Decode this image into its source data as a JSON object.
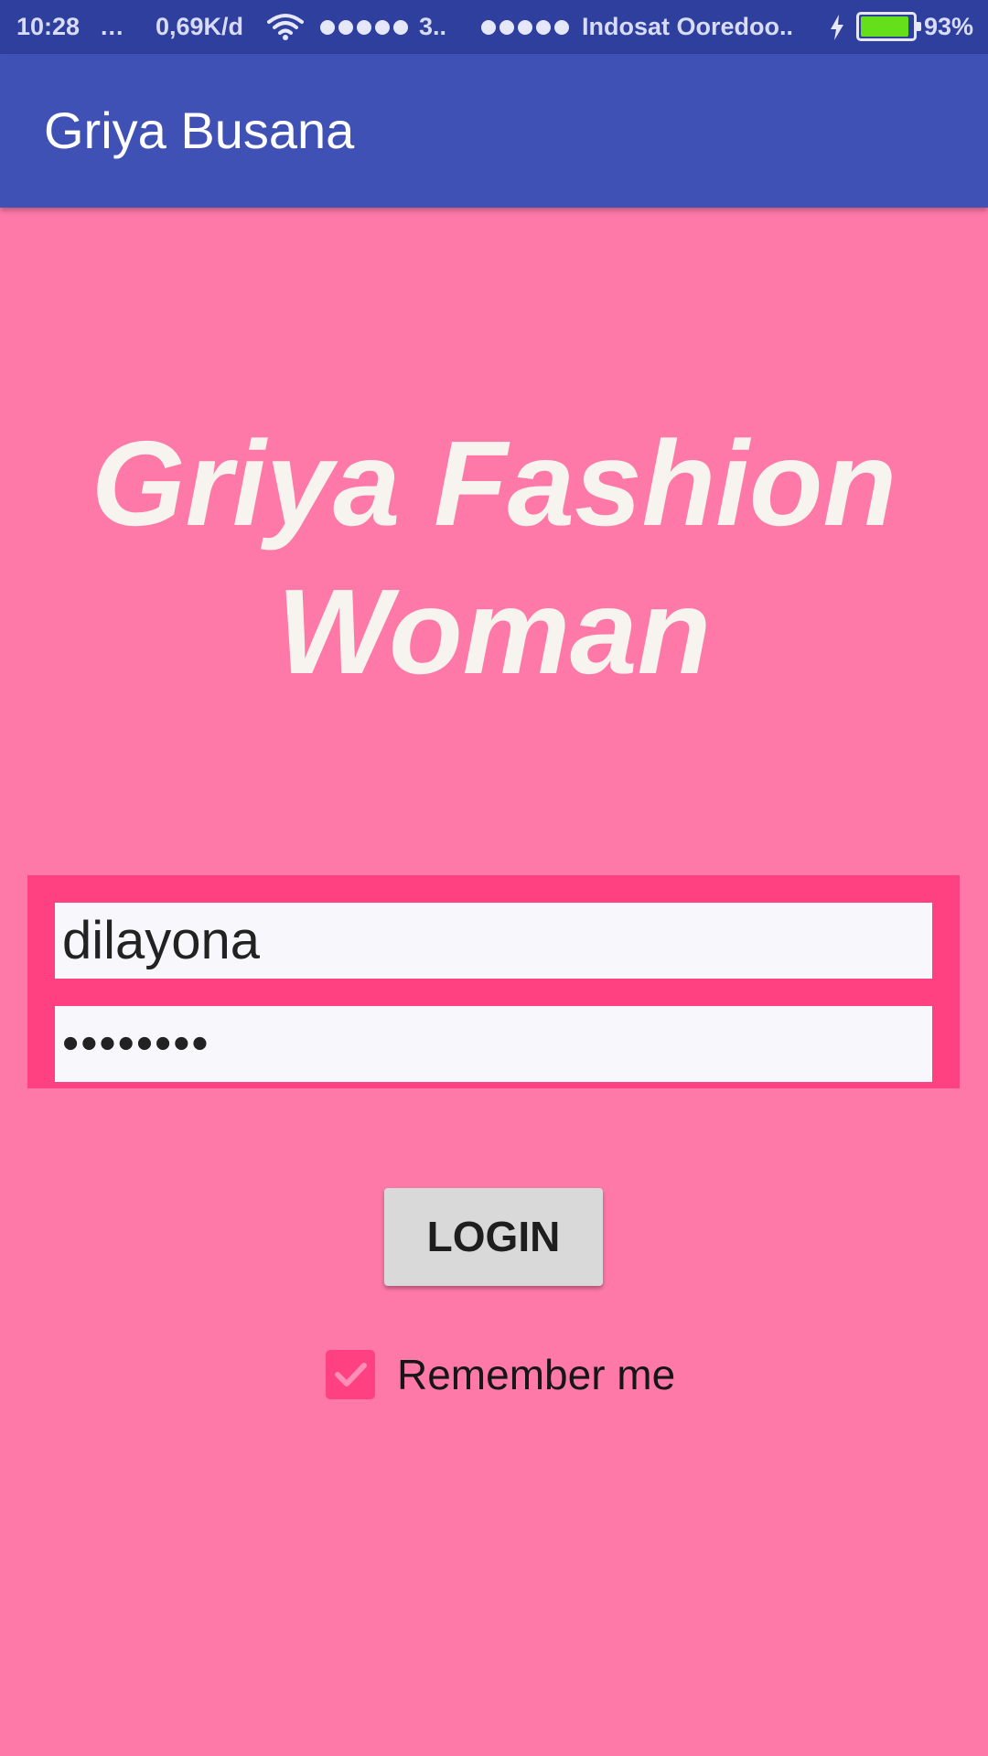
{
  "status_bar": {
    "time": "10:28",
    "more": "...",
    "network_speed": "0,69K/d",
    "sim1_network": "3..",
    "carrier": "Indosat Ooredoo..",
    "battery_level": 93,
    "battery_text": "93%",
    "icons": [
      "wifi-icon",
      "charging-icon",
      "battery-icon"
    ]
  },
  "app_bar": {
    "title": "Griya Busana"
  },
  "headline": {
    "line1": "Griya Fashion",
    "line2": "Woman"
  },
  "login_form": {
    "username_value": "dilayona",
    "password_value": "••••••••",
    "login_label": "LOGIN",
    "remember_label": "Remember me",
    "remember_checked": true
  },
  "colors": {
    "background": "#FF79A8",
    "form_accent": "#FF4081",
    "app_bar": "#3F51B5",
    "status_bar": "#2F3F9E",
    "headline_text": "#F7F3EF",
    "battery_fill": "#64E01B"
  }
}
